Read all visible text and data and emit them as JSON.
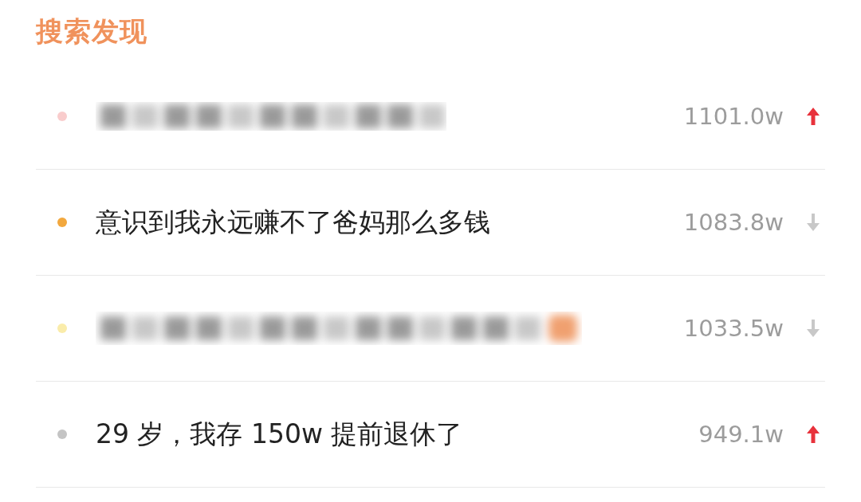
{
  "title": "搜索发现",
  "items": [
    {
      "kind": "blurred",
      "color": "#f9cccc",
      "badge": false,
      "count": "1101.0w",
      "rising": true
    },
    {
      "kind": "text",
      "color": "#f2a83e",
      "title": "意识到我永远赚不了爸妈那么多钱",
      "count": "1083.8w",
      "rising": false
    },
    {
      "kind": "blurred",
      "color": "#faecaa",
      "badge": true,
      "count": "1033.5w",
      "rising": false
    },
    {
      "kind": "text",
      "color": "#c4c4c4",
      "title": "29 岁，我存 150w 提前退休了",
      "count": "949.1w",
      "rising": true
    }
  ]
}
